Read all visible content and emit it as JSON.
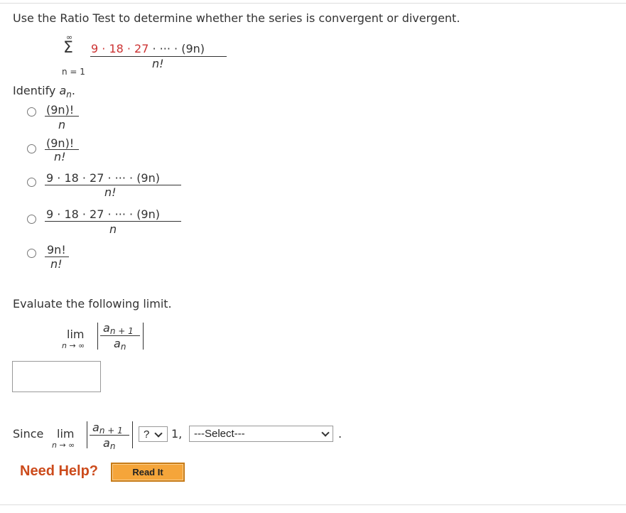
{
  "question": {
    "prompt": "Use the Ratio Test to determine whether the series is convergent or divergent.",
    "series": {
      "sigma": "Σ",
      "upper_limit": "∞",
      "lower_limit": "n = 1",
      "numerator_red": "9 · 18 · 27",
      "numerator_rest": " · ··· · (9n)",
      "denominator": "n!"
    }
  },
  "identify": {
    "label": "Identify ",
    "term": "a",
    "sub": "n",
    "period": ".",
    "options": [
      {
        "numerator": "(9n)!",
        "denominator": "n"
      },
      {
        "numerator": "(9n)!",
        "denominator": "n!"
      },
      {
        "numerator": "9 · 18 · 27 · ··· · (9n)",
        "denominator": "n!"
      },
      {
        "numerator": "9 · 18 · 27 · ··· · (9n)",
        "denominator": "n"
      },
      {
        "numerator": "9n!",
        "denominator": "n!"
      }
    ]
  },
  "limit": {
    "label": "Evaluate the following limit.",
    "lim": "lim",
    "lim_sub": "n → ∞",
    "num_term": "a",
    "num_sub": "n + 1",
    "den_term": "a",
    "den_sub": "n",
    "answer_value": ""
  },
  "since": {
    "label": "Since",
    "comparison_select": "?",
    "value": "1,",
    "conclusion_select": "---Select---",
    "end": "."
  },
  "help": {
    "label": "Need Help?",
    "button": "Read It"
  }
}
